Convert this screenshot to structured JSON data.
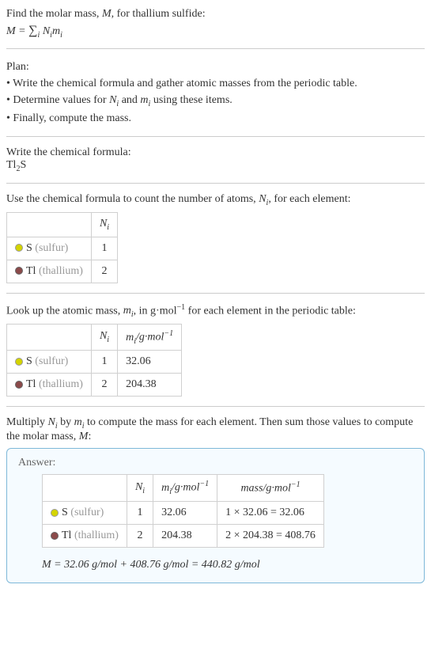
{
  "intro": {
    "line1": "Find the molar mass, M, for thallium sulfide:",
    "formula": "M = ∑",
    "formula_sub": "i",
    "formula_rest": " Nᵢmᵢ"
  },
  "plan": {
    "header": "Plan:",
    "item1": "• Write the chemical formula and gather atomic masses from the periodic table.",
    "item2": "• Determine values for Nᵢ and mᵢ using these items.",
    "item3": "• Finally, compute the mass."
  },
  "step1": {
    "header": "Write the chemical formula:",
    "formula_base": "Tl",
    "formula_sub": "2",
    "formula_end": "S"
  },
  "step2": {
    "header": "Use the chemical formula to count the number of atoms, Nᵢ, for each element:",
    "th_n": "Nᵢ",
    "elements": [
      {
        "name": "S",
        "label": "(sulfur)",
        "n": "1"
      },
      {
        "name": "Tl",
        "label": "(thallium)",
        "n": "2"
      }
    ]
  },
  "step3": {
    "header": "Look up the atomic mass, mᵢ, in g·mol⁻¹ for each element in the periodic table:",
    "th_n": "Nᵢ",
    "th_m": "mᵢ/g·mol⁻¹",
    "elements": [
      {
        "name": "S",
        "label": "(sulfur)",
        "n": "1",
        "m": "32.06"
      },
      {
        "name": "Tl",
        "label": "(thallium)",
        "n": "2",
        "m": "204.38"
      }
    ]
  },
  "step4": {
    "header": "Multiply Nᵢ by mᵢ to compute the mass for each element. Then sum those values to compute the molar mass, M:"
  },
  "answer": {
    "label": "Answer:",
    "th_n": "Nᵢ",
    "th_m": "mᵢ/g·mol⁻¹",
    "th_mass": "mass/g·mol⁻¹",
    "rows": [
      {
        "name": "S",
        "label": "(sulfur)",
        "n": "1",
        "m": "32.06",
        "mass": "1 × 32.06 = 32.06"
      },
      {
        "name": "Tl",
        "label": "(thallium)",
        "n": "2",
        "m": "204.38",
        "mass": "2 × 204.38 = 408.76"
      }
    ],
    "final": "M = 32.06 g/mol + 408.76 g/mol = 440.82 g/mol"
  }
}
